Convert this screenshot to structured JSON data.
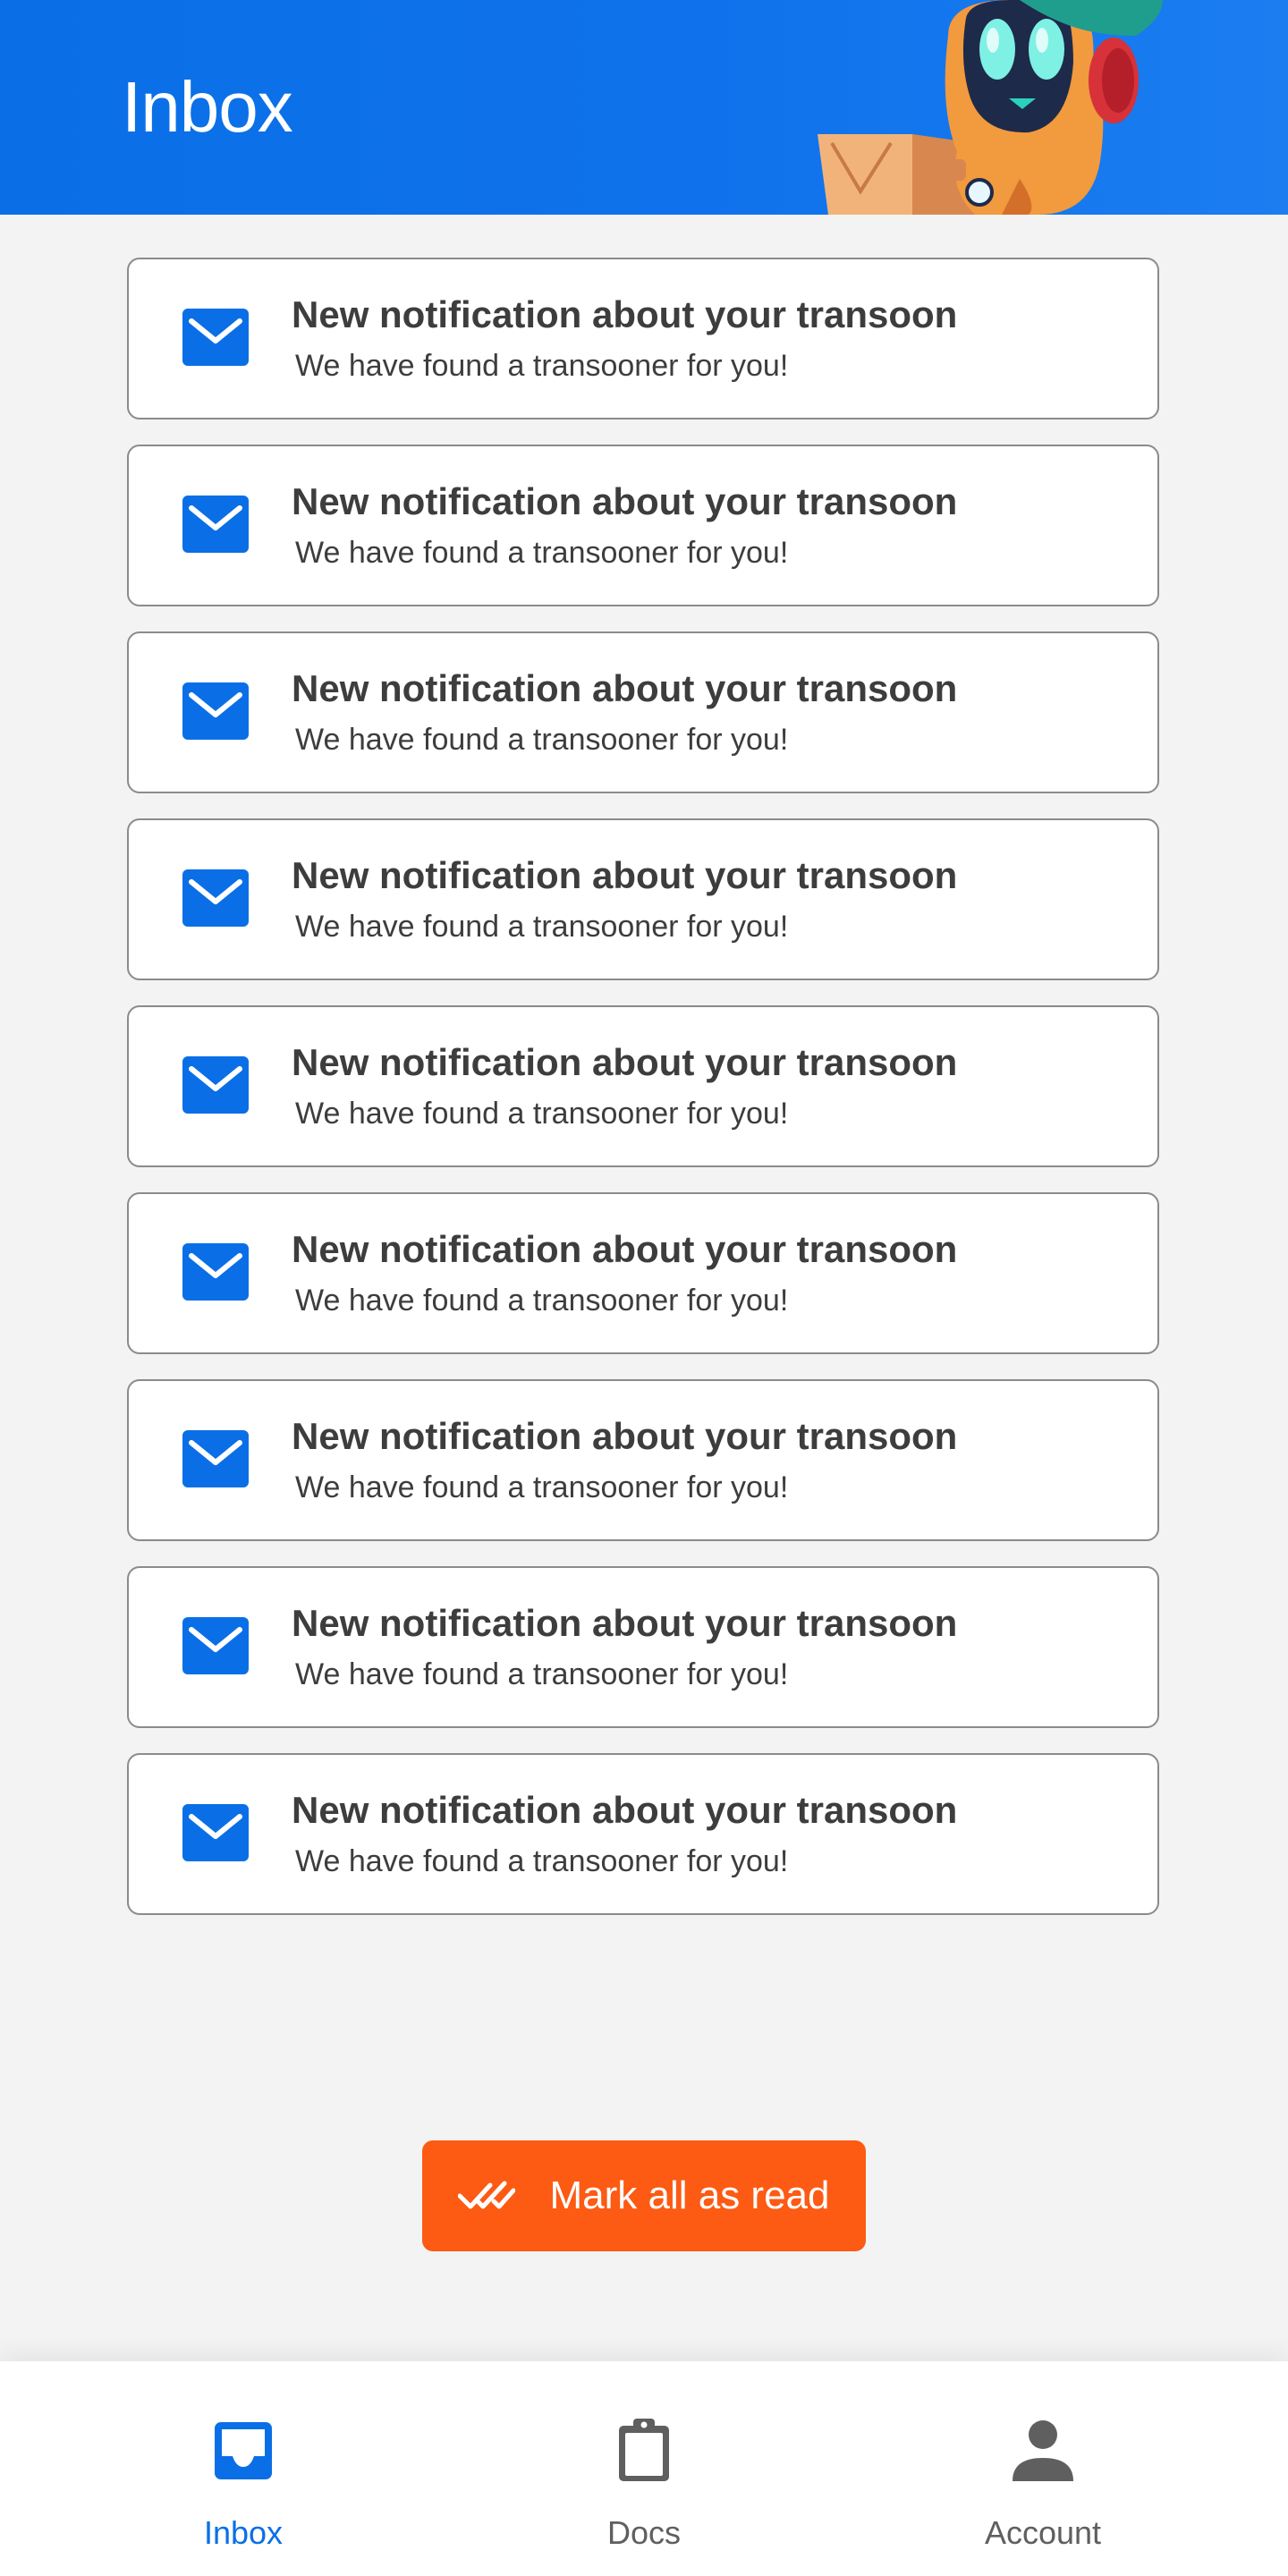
{
  "header": {
    "title": "Inbox"
  },
  "notifications": [
    {
      "title": "New notification about your transoon",
      "subtitle": "We have found a transooner for you!",
      "icon": "mail-icon"
    },
    {
      "title": "New notification about your transoon",
      "subtitle": "We have found a transooner for you!",
      "icon": "mail-icon"
    },
    {
      "title": "New notification about your transoon",
      "subtitle": "We have found a transooner for you!",
      "icon": "mail-icon"
    },
    {
      "title": "New notification about your transoon",
      "subtitle": "We have found a transooner for you!",
      "icon": "mail-icon"
    },
    {
      "title": "New notification about your transoon",
      "subtitle": "We have found a transooner for you!",
      "icon": "mail-icon"
    },
    {
      "title": "New notification about your transoon",
      "subtitle": "We have found a transooner for you!",
      "icon": "mail-icon"
    },
    {
      "title": "New notification about your transoon",
      "subtitle": "We have found a transooner for you!",
      "icon": "mail-icon"
    },
    {
      "title": "New notification about your transoon",
      "subtitle": "We have found a transooner for you!",
      "icon": "mail-icon"
    },
    {
      "title": "New notification about your transoon",
      "subtitle": "We have found a transooner for you!",
      "icon": "mail-icon"
    }
  ],
  "actions": {
    "mark_all_read_label": "Mark all as read",
    "mark_all_read_icon": "double-check-icon"
  },
  "bottom_nav": {
    "items": [
      {
        "label": "Inbox",
        "icon": "inbox-icon",
        "active": true
      },
      {
        "label": "Docs",
        "icon": "clipboard-icon",
        "active": false
      },
      {
        "label": "Account",
        "icon": "person-icon",
        "active": false
      }
    ]
  },
  "colors": {
    "header_bg": "#0a6fe6",
    "accent_blue": "#0a6fe6",
    "action_orange": "#fd5a13",
    "text_dark": "#3d3d3d",
    "nav_inactive": "#5f5f5f",
    "page_bg": "#f3f3f3"
  }
}
